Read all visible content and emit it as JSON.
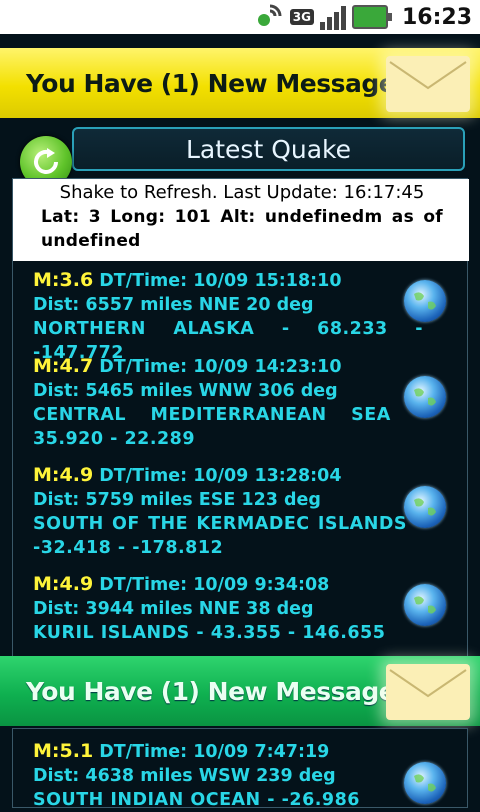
{
  "status_bar": {
    "time": "16:23",
    "network_label": "3G",
    "icons": [
      "sync-icon",
      "3g-icon",
      "signal-icon",
      "battery-icon"
    ]
  },
  "banner_message": "You Have (1) New Message",
  "header": {
    "title": "Latest Quake"
  },
  "info": {
    "refresh_text": "Shake to Refresh. Last Update: 16:17:45",
    "location_text": "Lat: 3  Long: 101  Alt: undefinedm as of undefined"
  },
  "quakes": [
    {
      "magnitude": "M:3.6",
      "datetime": " DT/Time: 10/09 15:18:10",
      "distance": "Dist: 6557 miles NNE 20 deg",
      "location": "NORTHERN ALASKA - 68.233 - -147.772"
    },
    {
      "magnitude": "M:4.7",
      "datetime": " DT/Time: 10/09 14:23:10",
      "distance": "Dist: 5465 miles WNW 306 deg",
      "location": "CENTRAL MEDITERRANEAN SEA - 35.920 - 22.289"
    },
    {
      "magnitude": "M:4.9",
      "datetime": " DT/Time: 10/09 13:28:04",
      "distance": "Dist: 5759 miles ESE 123 deg",
      "location": "SOUTH OF THE KERMADEC ISLANDS - -32.418 - -178.812"
    },
    {
      "magnitude": "M:4.9",
      "datetime": " DT/Time: 10/09 9:34:08",
      "distance": "Dist: 3944 miles NNE 38 deg",
      "location": "KURIL ISLANDS - 43.355 - 146.655"
    },
    {
      "magnitude": "M:5.1",
      "datetime": " DT/Time: 10/09 7:47:19",
      "distance": "Dist: 4638 miles WSW 239 deg",
      "location": "SOUTH INDIAN OCEAN - -26.986"
    }
  ],
  "colors": {
    "magnitude": "#fff43a",
    "details": "#29d6e6",
    "banner_yellow": "#f3e000",
    "banner_green": "#0fb050"
  }
}
